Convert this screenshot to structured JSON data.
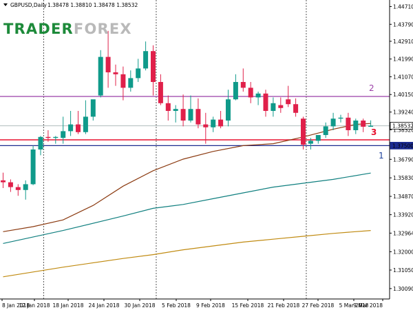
{
  "header": {
    "symbol": "GBPUSD,Daily",
    "ohlc": "1.38478 1.38810 1.38478 1.38532"
  },
  "logo": {
    "part1": "TRADER",
    "part2": "FOREX",
    "color1": "#1d8a3a",
    "color2": "#b9b9b9"
  },
  "chart_data": {
    "type": "candlestick",
    "y_ticks": [
      1.3009,
      1.3105,
      1.32,
      1.32964,
      1.3392,
      1.3487,
      1.3583,
      1.3679,
      1.3832,
      1.3924,
      1.4015,
      1.4107,
      1.4199,
      1.4291,
      1.4379,
      1.4471
    ],
    "x_ticks": [
      "8 Jan 2018",
      "12 Jan 2018",
      "18 Jan 2018",
      "24 Jan 2018",
      "30 Jan 2018",
      "5 Feb 2018",
      "9 Feb 2018",
      "15 Feb 2018",
      "21 Feb 2018",
      "27 Feb 2018",
      "5 Mar 2018",
      "9 Mar 2018"
    ],
    "ylim": [
      1.2955,
      1.4505
    ],
    "candles": [
      {
        "o": 1.357,
        "h": 1.361,
        "l": 1.353,
        "c": 1.356
      },
      {
        "o": 1.356,
        "h": 1.3575,
        "l": 1.351,
        "c": 1.3535
      },
      {
        "o": 1.3535,
        "h": 1.355,
        "l": 1.349,
        "c": 1.352
      },
      {
        "o": 1.352,
        "h": 1.357,
        "l": 1.347,
        "c": 1.355
      },
      {
        "o": 1.355,
        "h": 1.375,
        "l": 1.3545,
        "c": 1.373
      },
      {
        "o": 1.373,
        "h": 1.38,
        "l": 1.37,
        "c": 1.3795
      },
      {
        "o": 1.3795,
        "h": 1.383,
        "l": 1.377,
        "c": 1.379
      },
      {
        "o": 1.379,
        "h": 1.38,
        "l": 1.376,
        "c": 1.3795
      },
      {
        "o": 1.379,
        "h": 1.39,
        "l": 1.376,
        "c": 1.3825
      },
      {
        "o": 1.3825,
        "h": 1.393,
        "l": 1.38,
        "c": 1.386
      },
      {
        "o": 1.386,
        "h": 1.393,
        "l": 1.381,
        "c": 1.382
      },
      {
        "o": 1.382,
        "h": 1.3985,
        "l": 1.381,
        "c": 1.39
      },
      {
        "o": 1.39,
        "h": 1.395,
        "l": 1.388,
        "c": 1.399
      },
      {
        "o": 1.401,
        "h": 1.4245,
        "l": 1.4,
        "c": 1.421
      },
      {
        "o": 1.421,
        "h": 1.4345,
        "l": 1.405,
        "c": 1.413
      },
      {
        "o": 1.413,
        "h": 1.417,
        "l": 1.406,
        "c": 1.412
      },
      {
        "o": 1.412,
        "h": 1.416,
        "l": 1.3985,
        "c": 1.405
      },
      {
        "o": 1.405,
        "h": 1.414,
        "l": 1.403,
        "c": 1.41
      },
      {
        "o": 1.41,
        "h": 1.42,
        "l": 1.408,
        "c": 1.415
      },
      {
        "o": 1.415,
        "h": 1.429,
        "l": 1.414,
        "c": 1.424
      },
      {
        "o": 1.424,
        "h": 1.427,
        "l": 1.401,
        "c": 1.408
      },
      {
        "o": 1.408,
        "h": 1.412,
        "l": 1.396,
        "c": 1.397
      },
      {
        "o": 1.397,
        "h": 1.401,
        "l": 1.388,
        "c": 1.393
      },
      {
        "o": 1.393,
        "h": 1.396,
        "l": 1.387,
        "c": 1.394
      },
      {
        "o": 1.394,
        "h": 1.4015,
        "l": 1.385,
        "c": 1.388
      },
      {
        "o": 1.388,
        "h": 1.401,
        "l": 1.387,
        "c": 1.394
      },
      {
        "o": 1.394,
        "h": 1.3995,
        "l": 1.384,
        "c": 1.386
      },
      {
        "o": 1.386,
        "h": 1.392,
        "l": 1.376,
        "c": 1.3845
      },
      {
        "o": 1.3845,
        "h": 1.39,
        "l": 1.382,
        "c": 1.3885
      },
      {
        "o": 1.3885,
        "h": 1.393,
        "l": 1.384,
        "c": 1.385
      },
      {
        "o": 1.388,
        "h": 1.404,
        "l": 1.385,
        "c": 1.399
      },
      {
        "o": 1.399,
        "h": 1.412,
        "l": 1.3985,
        "c": 1.408
      },
      {
        "o": 1.408,
        "h": 1.415,
        "l": 1.403,
        "c": 1.405
      },
      {
        "o": 1.405,
        "h": 1.408,
        "l": 1.397,
        "c": 1.4
      },
      {
        "o": 1.4,
        "h": 1.403,
        "l": 1.396,
        "c": 1.402
      },
      {
        "o": 1.402,
        "h": 1.404,
        "l": 1.39,
        "c": 1.393
      },
      {
        "o": 1.393,
        "h": 1.4,
        "l": 1.39,
        "c": 1.397
      },
      {
        "o": 1.396,
        "h": 1.4,
        "l": 1.392,
        "c": 1.3945
      },
      {
        "o": 1.399,
        "h": 1.406,
        "l": 1.395,
        "c": 1.3965
      },
      {
        "o": 1.3965,
        "h": 1.3995,
        "l": 1.39,
        "c": 1.392
      },
      {
        "o": 1.389,
        "h": 1.39,
        "l": 1.373,
        "c": 1.3755
      },
      {
        "o": 1.376,
        "h": 1.379,
        "l": 1.373,
        "c": 1.3775
      },
      {
        "o": 1.3775,
        "h": 1.38,
        "l": 1.376,
        "c": 1.3805
      },
      {
        "o": 1.3805,
        "h": 1.387,
        "l": 1.379,
        "c": 1.385
      },
      {
        "o": 1.385,
        "h": 1.392,
        "l": 1.383,
        "c": 1.389
      },
      {
        "o": 1.389,
        "h": 1.391,
        "l": 1.387,
        "c": 1.3895
      },
      {
        "o": 1.3895,
        "h": 1.392,
        "l": 1.38,
        "c": 1.383
      },
      {
        "o": 1.383,
        "h": 1.389,
        "l": 1.381,
        "c": 1.388
      },
      {
        "o": 1.388,
        "h": 1.389,
        "l": 1.382,
        "c": 1.3848
      },
      {
        "o": 1.38478,
        "h": 1.3881,
        "l": 1.38478,
        "c": 1.38532
      }
    ],
    "moving_averages": [
      {
        "color": "#8b3a10",
        "points": [
          [
            0,
            1.3304
          ],
          [
            4,
            1.333
          ],
          [
            8,
            1.3365
          ],
          [
            12,
            1.344
          ],
          [
            16,
            1.354
          ],
          [
            20,
            1.362
          ],
          [
            24,
            1.368
          ],
          [
            28,
            1.372
          ],
          [
            32,
            1.375
          ],
          [
            36,
            1.376
          ],
          [
            40,
            1.3795
          ],
          [
            44,
            1.3835
          ],
          [
            47,
            1.386
          ],
          [
            49,
            1.3865
          ]
        ]
      },
      {
        "color": "#0f7f7f",
        "points": [
          [
            0,
            1.3243
          ],
          [
            8,
            1.331
          ],
          [
            16,
            1.3385
          ],
          [
            20,
            1.3425
          ],
          [
            24,
            1.3445
          ],
          [
            28,
            1.3475
          ],
          [
            32,
            1.3505
          ],
          [
            36,
            1.3535
          ],
          [
            40,
            1.3555
          ],
          [
            44,
            1.3575
          ],
          [
            49,
            1.3608
          ]
        ]
      },
      {
        "color": "#c08a10",
        "points": [
          [
            0,
            1.307
          ],
          [
            8,
            1.312
          ],
          [
            16,
            1.3165
          ],
          [
            20,
            1.3185
          ],
          [
            24,
            1.321
          ],
          [
            28,
            1.323
          ],
          [
            32,
            1.325
          ],
          [
            36,
            1.3265
          ],
          [
            40,
            1.328
          ],
          [
            44,
            1.3295
          ],
          [
            49,
            1.331
          ]
        ]
      }
    ],
    "horizontal_lines": [
      {
        "price": 1.4005,
        "color": "#9b3fa7",
        "label": "2"
      },
      {
        "price": 1.3853,
        "color": "#b8c4c4",
        "label": ""
      },
      {
        "price": 1.378,
        "color": "#e8112e",
        "label": "3"
      },
      {
        "price": 1.375,
        "color": "#1b2a8f",
        "label": "1"
      }
    ],
    "price_labels": [
      "1.38532",
      "1.37500"
    ],
    "vertical_separators": [
      5,
      20,
      40
    ]
  },
  "annotations": {
    "label_1": "1",
    "label_2": "2",
    "label_3": "3"
  },
  "colors": {
    "bull": "#0f9a8a",
    "bear": "#e0204a",
    "axis": "#000000",
    "label1": "#1b3f9a",
    "label2": "#9b3fa7",
    "label3": "#e8112e"
  }
}
